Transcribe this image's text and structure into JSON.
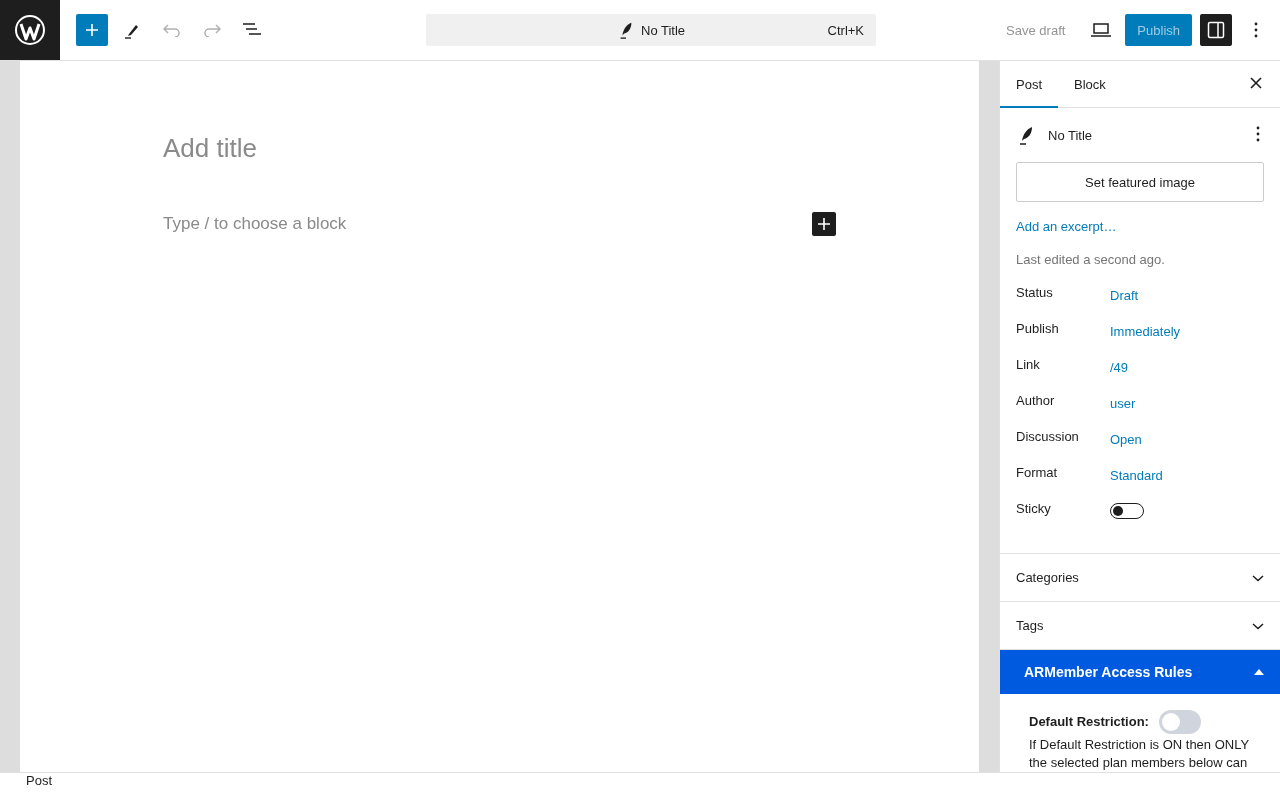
{
  "toolbar": {
    "document_title": "No Title",
    "shortcut": "Ctrl+K",
    "save_draft": "Save draft",
    "publish": "Publish",
    "publish_disabled": true,
    "undo_disabled": true,
    "redo_disabled": true,
    "settings_open": true
  },
  "editor": {
    "title_placeholder": "Add title",
    "block_placeholder": "Type / to choose a block"
  },
  "sidebar": {
    "tabs": [
      {
        "label": "Post",
        "selected": true
      },
      {
        "label": "Block",
        "selected": false
      }
    ],
    "post_title": "No Title",
    "featured_image_button": "Set featured image",
    "excerpt_link": "Add an excerpt…",
    "last_edited": "Last edited a second ago.",
    "properties": [
      {
        "label": "Status",
        "kind": "link",
        "value": "Draft"
      },
      {
        "label": "Publish",
        "kind": "link",
        "value": "Immediately"
      },
      {
        "label": "Link",
        "kind": "link",
        "value": "/49"
      },
      {
        "label": "Author",
        "kind": "link",
        "value": "user"
      },
      {
        "label": "Discussion",
        "kind": "link",
        "value": "Open"
      },
      {
        "label": "Format",
        "kind": "link",
        "value": "Standard"
      },
      {
        "label": "Sticky",
        "kind": "toggle",
        "on": false
      }
    ],
    "panels": [
      {
        "title": "Categories",
        "expanded": false
      },
      {
        "title": "Tags",
        "expanded": false
      }
    ],
    "armember": {
      "title": "ARMember Access Rules",
      "expanded": true,
      "restriction_label": "Default Restriction:",
      "restriction_on": false,
      "description": "If Default Restriction is ON then ONLY the selected plan members below can"
    }
  },
  "status_bar": {
    "breadcrumb": "Post"
  }
}
